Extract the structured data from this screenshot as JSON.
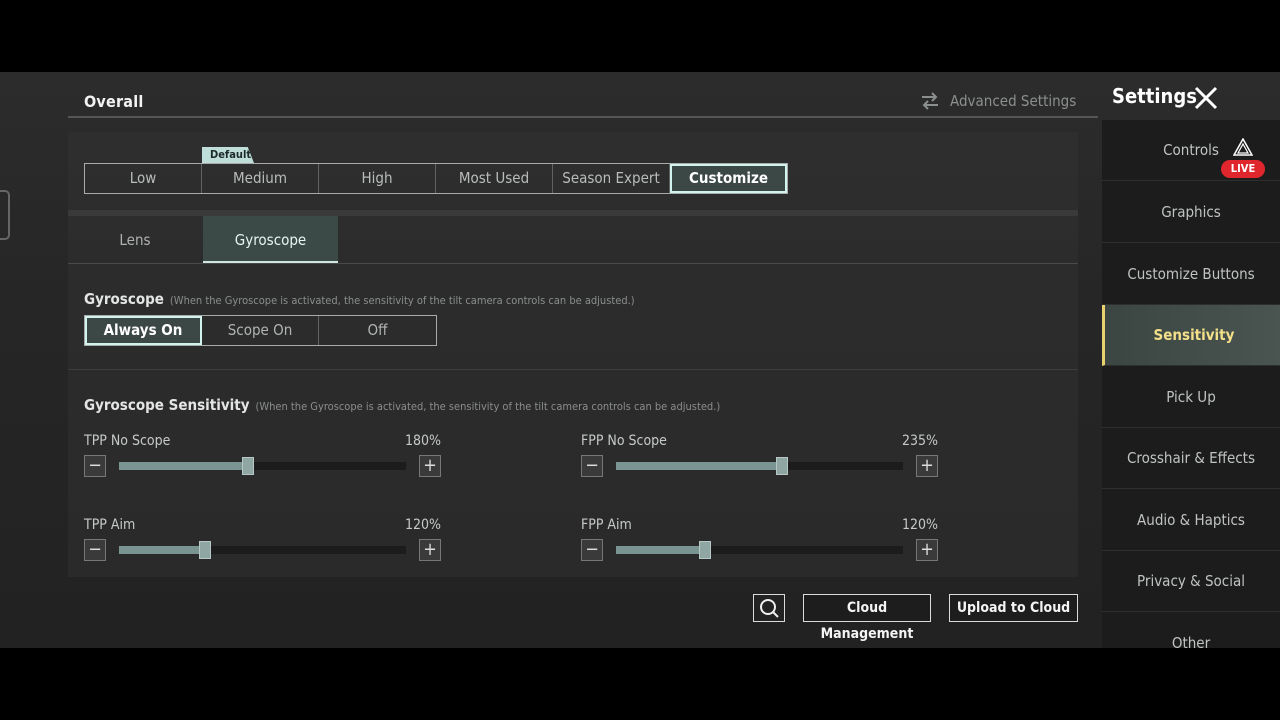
{
  "header": {
    "section_title": "Overall",
    "advanced_settings_label": "Advanced Settings",
    "settings_title": "Settings"
  },
  "presets": {
    "default_badge": "Default",
    "items": [
      "Low",
      "Medium",
      "High",
      "Most Used",
      "Season Expert",
      "Customize"
    ],
    "selected": "Customize"
  },
  "subtabs": {
    "items": [
      "Lens",
      "Gyroscope"
    ],
    "selected": "Gyroscope"
  },
  "gyroscope": {
    "label": "Gyroscope",
    "hint": "(When the Gyroscope is activated, the sensitivity of the tilt camera controls can be adjusted.)",
    "modes": [
      "Always On",
      "Scope On",
      "Off"
    ],
    "selected": "Always On"
  },
  "sensitivity": {
    "label": "Gyroscope Sensitivity",
    "hint": "(When the Gyroscope is activated, the sensitivity of the tilt camera controls can be adjusted.)",
    "sliders": [
      {
        "label": "TPP No Scope",
        "value_text": "180%",
        "fraction": 0.45
      },
      {
        "label": "FPP No Scope",
        "value_text": "235%",
        "fraction": 0.58
      },
      {
        "label": "TPP Aim",
        "value_text": "120%",
        "fraction": 0.3
      },
      {
        "label": "FPP Aim",
        "value_text": "120%",
        "fraction": 0.31
      }
    ]
  },
  "buttons": {
    "cloud_management": "Cloud Management",
    "upload_to_cloud": "Upload to Cloud"
  },
  "sidebar": {
    "items": [
      "Controls",
      "Graphics",
      "Customize Buttons",
      "Sensitivity",
      "Pick Up",
      "Crosshair & Effects",
      "Audio & Haptics",
      "Privacy & Social",
      "Other"
    ],
    "selected": "Sensitivity",
    "live_badge": "LIVE"
  },
  "colors": {
    "accent_teal": "#d3f3ee",
    "active_tab_yellow": "#f3e089",
    "live_red": "#e0262d"
  }
}
